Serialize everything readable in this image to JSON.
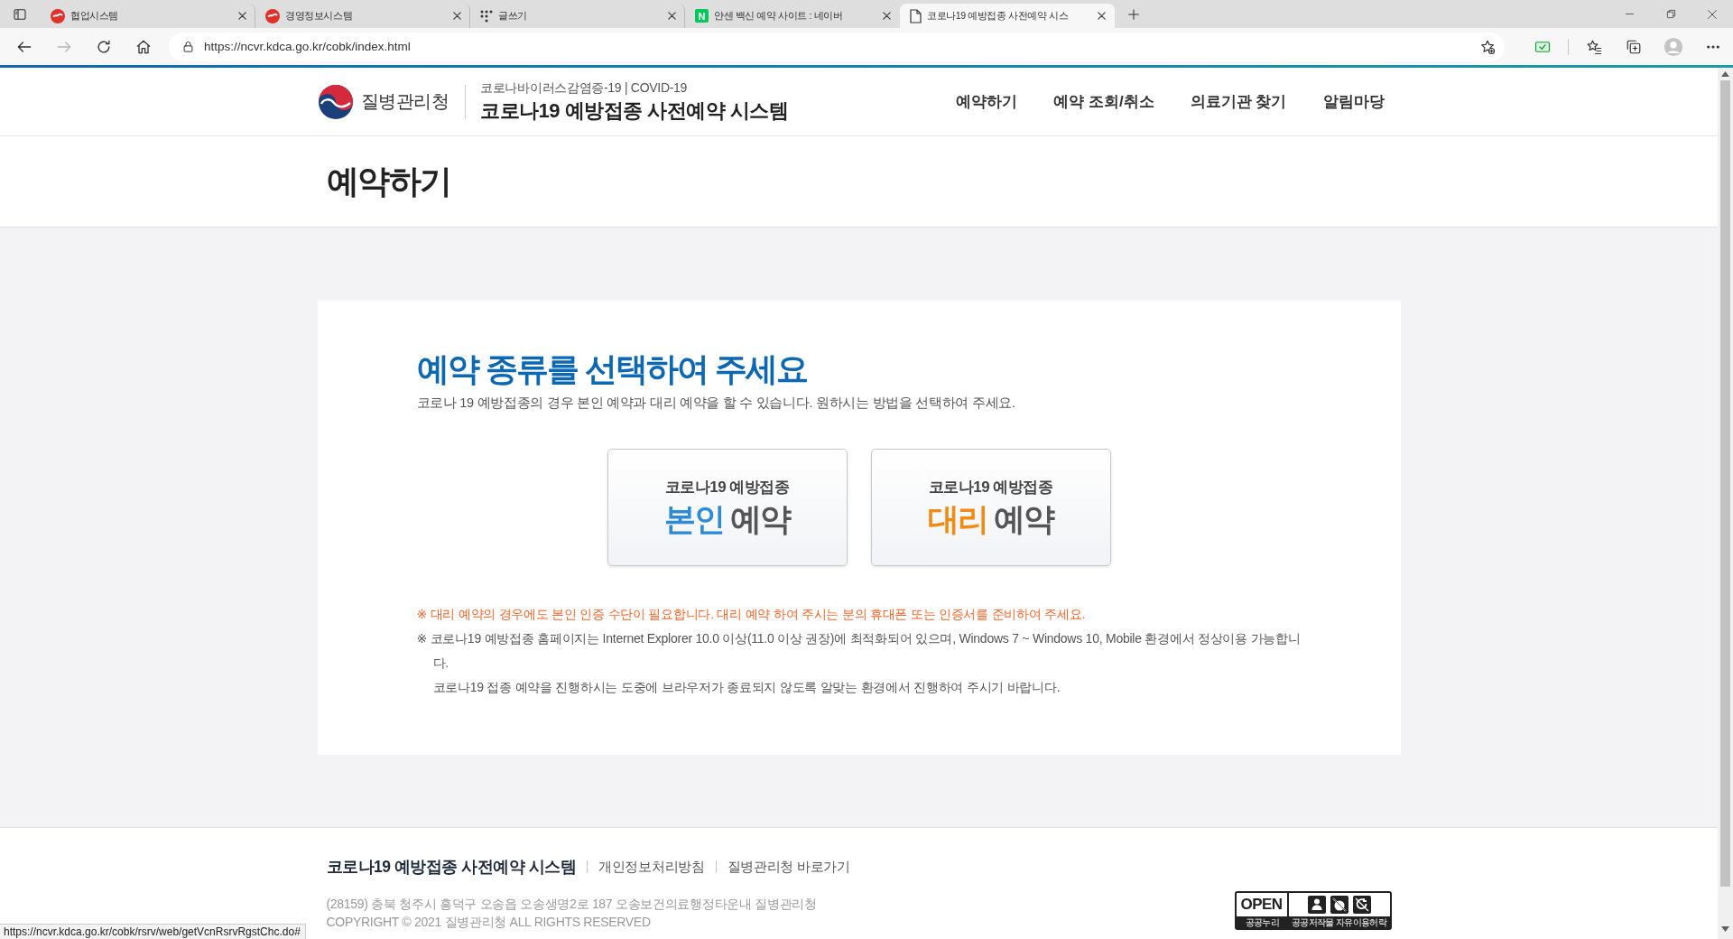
{
  "browser": {
    "tabs": [
      {
        "title": "협업시스템",
        "kind": "agency",
        "selected": false
      },
      {
        "title": "경영정보시스템",
        "kind": "agency",
        "selected": false
      },
      {
        "title": "글쓰기",
        "kind": "dots",
        "selected": false
      },
      {
        "title": "얀센 백신 예약 사이트 : 네이버",
        "kind": "letter",
        "logo_letter": "N",
        "selected": false
      },
      {
        "title": "코로나19 예방접종 사전예약 시스",
        "kind": "page",
        "selected": true
      }
    ],
    "nav_buttons": [
      {
        "kind": "back",
        "disabled": false
      },
      {
        "kind": "forward",
        "disabled": true
      },
      {
        "kind": "refresh",
        "disabled": false
      },
      {
        "kind": "home",
        "disabled": false
      }
    ],
    "address_bar": {
      "url": "https://ncvr.kdca.go.kr/cobk/index.html"
    },
    "status_url": "https://ncvr.kdca.go.kr/cobk/rsrv/web/getVcnRsrvRgstChc.do#"
  },
  "header": {
    "agency": "질병관리청",
    "subtitle": "코로나바이러스감염증-19 | COVID-19",
    "title": "코로나19 예방접종 사전예약 시스템",
    "nav": [
      {
        "label": "예약하기"
      },
      {
        "label": "예약 조회/취소"
      },
      {
        "label": "의료기관 찾기"
      },
      {
        "label": "알림마당"
      }
    ]
  },
  "page_title": "예약하기",
  "card": {
    "heading": "예약 종류를 선택하여 주세요",
    "description": "코로나 19 예방접종의 경우 본인 예약과 대리 예약을 할 수 있습니다. 원하시는 방법을 선택하여 주세요.",
    "options": [
      {
        "caption": "코로나19 예방접종",
        "highlight": "본인",
        "rest": "예약",
        "color": "#2d8ad6"
      },
      {
        "caption": "코로나19 예방접종",
        "highlight": "대리",
        "rest": "예약",
        "color": "#f08c14"
      }
    ],
    "notes": [
      {
        "kind": "alert",
        "text": "※ 대리 예약의 경우에도 본인 인증 수단이 필요합니다. 대리 예약 하여 주시는 분의 휴대폰 또는 인증서를 준비하여 주세요."
      },
      {
        "kind": "note",
        "text": "※ 코로나19 예방접종 홈페이지는 Internet Explorer 10.0 이상(11.0 이상 권장)에 최적화되어 있으며, Windows 7 ~ Windows 10, Mobile 환경에서 정상이용 가능합니다."
      },
      {
        "kind": "continuation",
        "text": "코로나19 접종 예약을 진행하시는 도중에 브라우저가 종료되지 않도록 알맞는 환경에서 진행하여 주시기 바랍니다."
      }
    ]
  },
  "footer": {
    "title": "코로나19 예방접종 사전예약 시스템",
    "links": [
      {
        "label": "개인정보처리방침"
      },
      {
        "label": "질병관리청 바로가기"
      }
    ],
    "address": "(28159) 충북 청주시 흥덕구 오송읍 오송생명2로 187 오송보건의료행정타운내 질병관리청",
    "copyright": "COPYRIGHT © 2021 질병관리청 ALL RIGHTS RESERVED",
    "license": {
      "label": "OPEN",
      "caption": "공공누리",
      "terms": "공공저작물 자유이용허락"
    }
  }
}
